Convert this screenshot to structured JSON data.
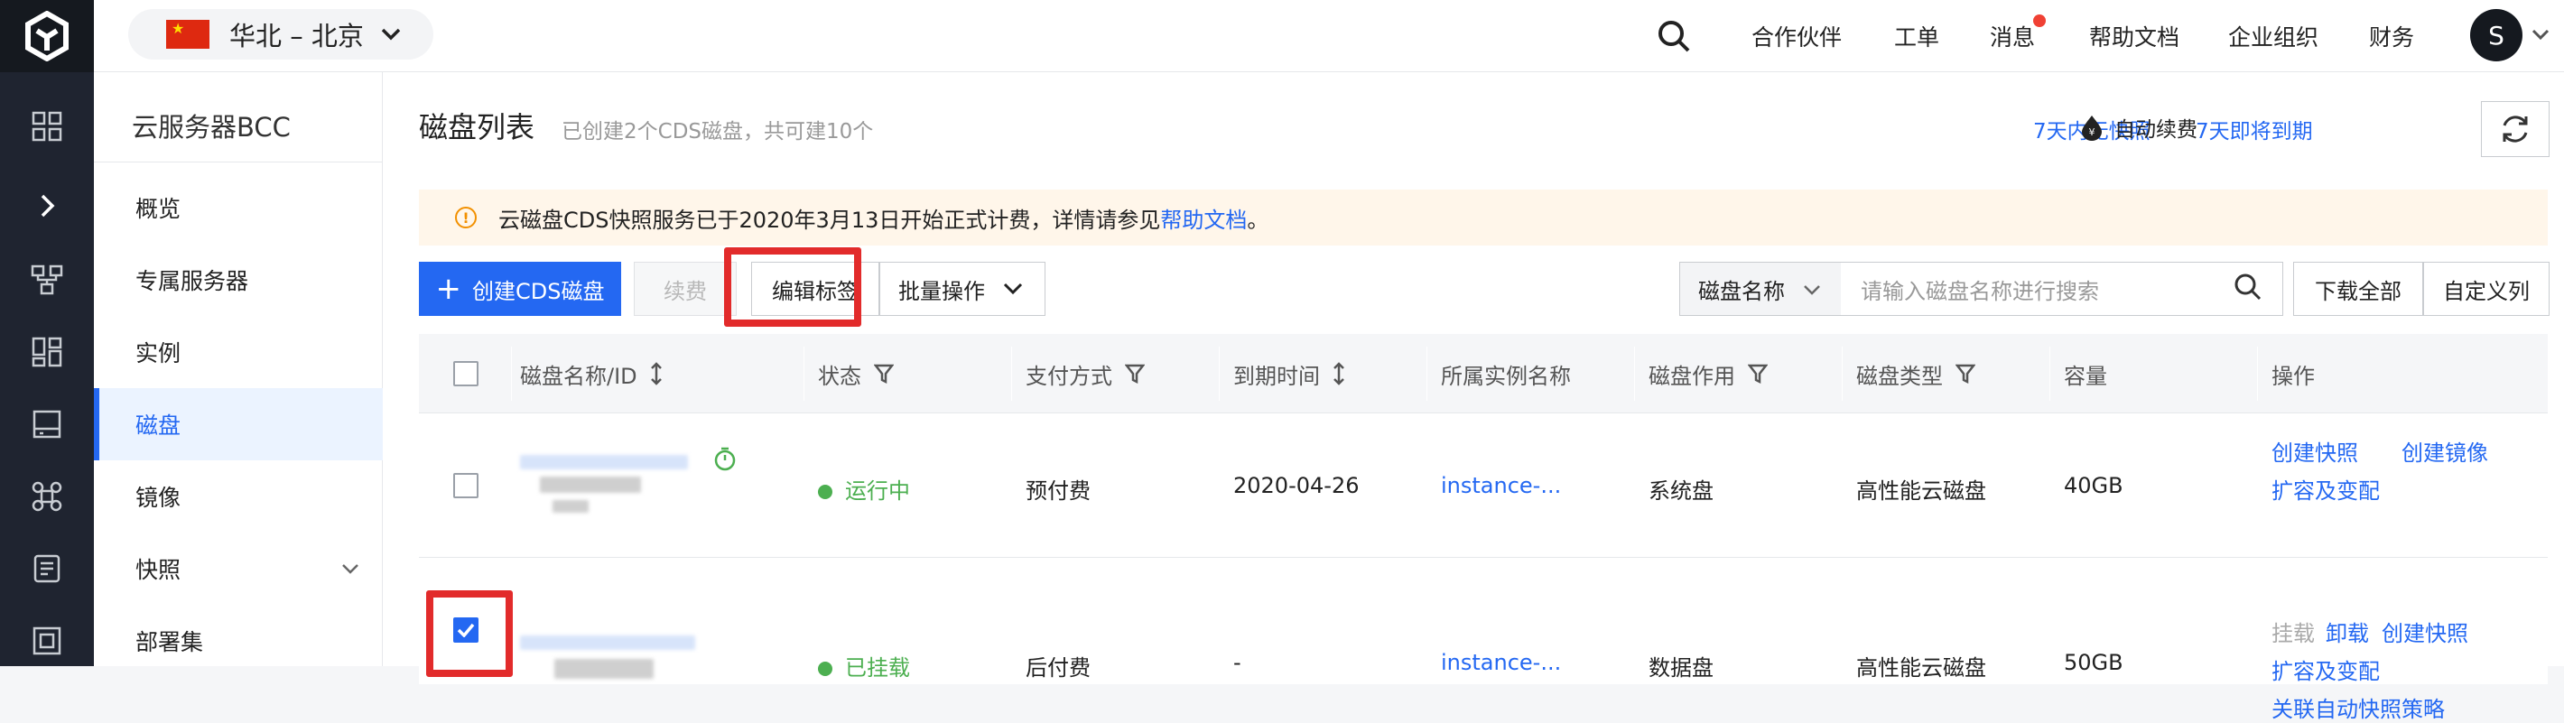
{
  "region": {
    "label": "华北 – 北京"
  },
  "topnav": {
    "partners": "合作伙伴",
    "tickets": "工单",
    "messages": "消息",
    "help_docs": "帮助文档",
    "org": "企业组织",
    "finance": "财务",
    "avatar": "S"
  },
  "sidebar": {
    "title": "云服务器BCC",
    "items": [
      {
        "label": "概览"
      },
      {
        "label": "专属服务器"
      },
      {
        "label": "实例"
      },
      {
        "label": "磁盘"
      },
      {
        "label": "镜像"
      },
      {
        "label": "快照"
      },
      {
        "label": "部署集"
      }
    ]
  },
  "page": {
    "title": "磁盘列表",
    "subtitle": "已创建2个CDS磁盘，共可建10个",
    "link_no_snapshot": "7天内无快照",
    "link_expiring": "7天即将到期",
    "auto_renew": "自动续费"
  },
  "notice": {
    "text": "云磁盘CDS快照服务已于2020年3月13日开始正式计费，详情请参见",
    "link": "帮助文档",
    "suffix": "。"
  },
  "toolbar": {
    "create": "创建CDS磁盘",
    "renew": "续费",
    "edit_tags": "编辑标签",
    "batch": "批量操作",
    "search_field": "磁盘名称",
    "search_placeholder": "请输入磁盘名称进行搜索",
    "download_all": "下载全部",
    "custom_columns": "自定义列"
  },
  "table": {
    "headers": {
      "name": "磁盘名称/ID",
      "status": "状态",
      "payment": "支付方式",
      "expiry": "到期时间",
      "instance": "所属实例名称",
      "usage": "磁盘作用",
      "type": "磁盘类型",
      "capacity": "容量",
      "actions": "操作"
    },
    "rows": [
      {
        "status": "运行中",
        "payment": "预付费",
        "expiry": "2020-04-26",
        "instance": "instance-...",
        "usage": "系统盘",
        "type": "高性能云磁盘",
        "capacity": "40GB",
        "actions": [
          "创建快照",
          "创建镜像",
          "扩容及变配"
        ]
      },
      {
        "status": "已挂载",
        "payment": "后付费",
        "expiry": "-",
        "instance": "instance-...",
        "usage": "数据盘",
        "type": "高性能云磁盘",
        "capacity": "50GB",
        "actions": [
          "挂载",
          "卸载",
          "创建快照",
          "扩容及变配",
          "关联自动快照策略"
        ]
      }
    ]
  }
}
